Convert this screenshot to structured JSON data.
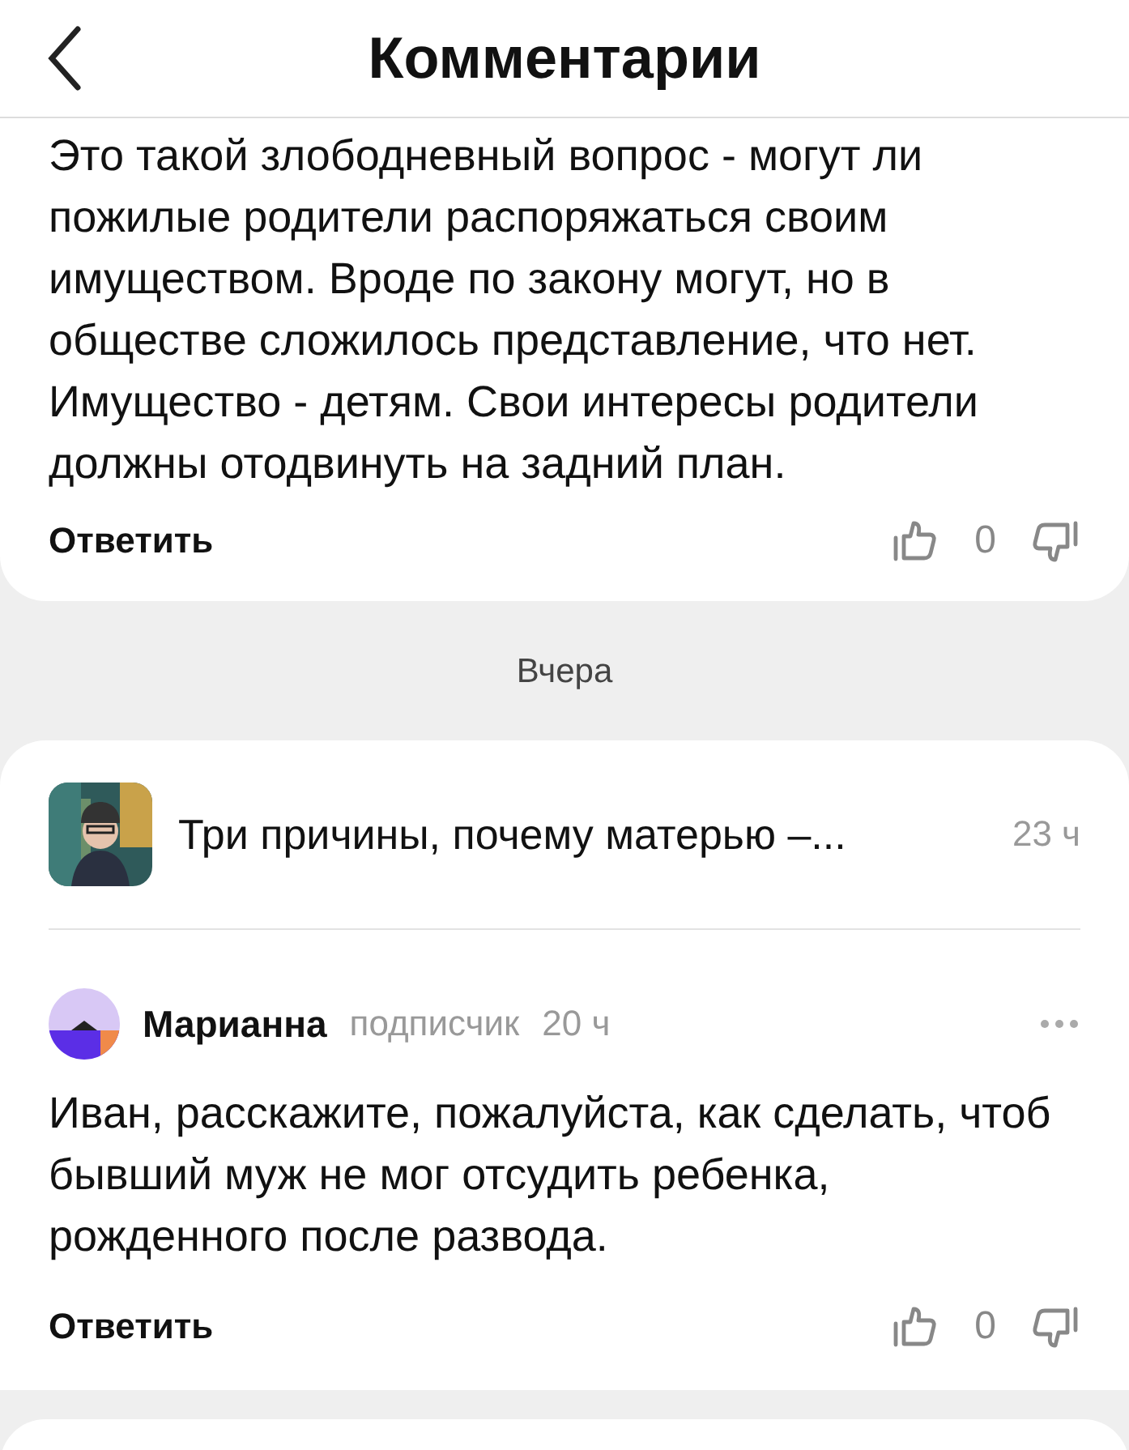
{
  "header": {
    "title": "Комментарии"
  },
  "top_comment": {
    "text": "Это такой злободневный вопрос - могут ли пожилые родители распоряжаться своим имуществом. Вроде по закону могут, но в обществе сложилось представление, что нет. Имущество - детям. Свои интересы родители должны отодвинуть на задний план.",
    "reply": "Ответить",
    "likes": "0"
  },
  "date_separator": "Вчера",
  "article": {
    "kind": "picture",
    "title": "Три причины, почему матерью –...",
    "time": "23 ч"
  },
  "comment": {
    "author": "Марианна",
    "badge": "подписчик",
    "time": "20 ч",
    "text": "Иван, расскажите, пожалуйста, как сделать, чтоб бывший муж не мог отсудить ребенка, рожденного после развода.",
    "reply": "Ответить",
    "likes": "0"
  }
}
